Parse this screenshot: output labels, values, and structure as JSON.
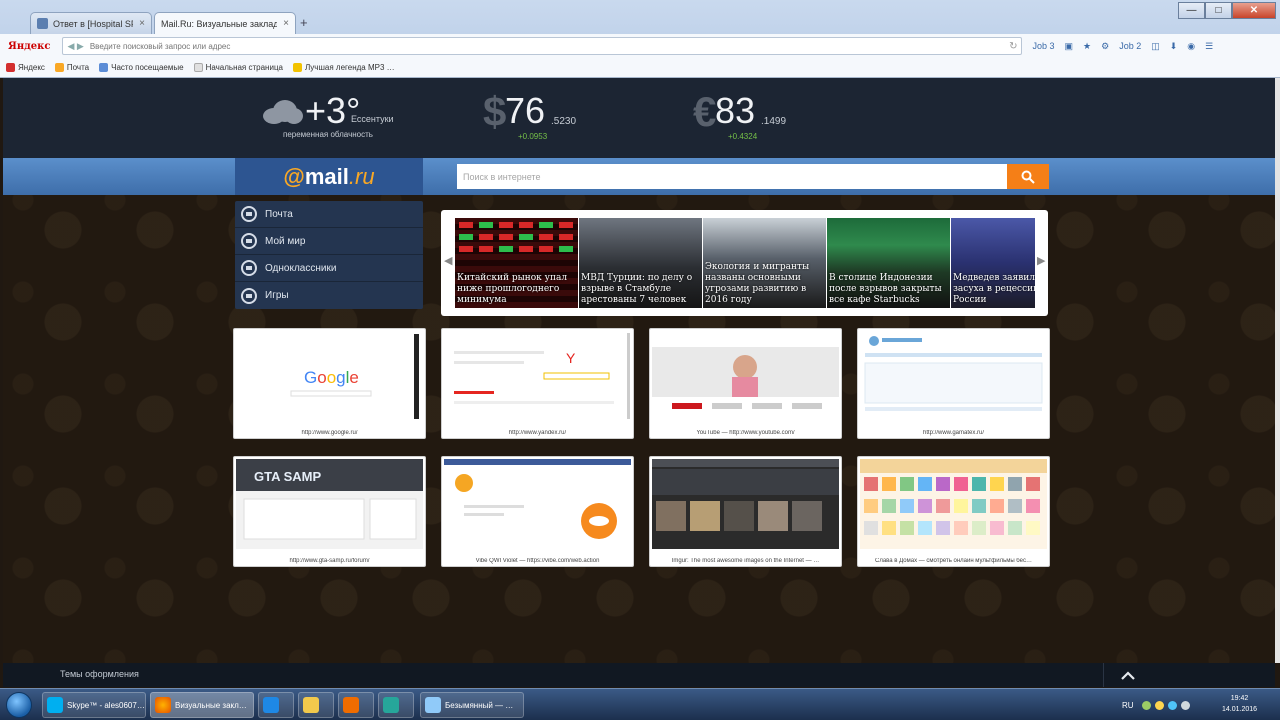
{
  "browser": {
    "tabs": [
      {
        "title": "Ответ в [Hospital SF] Отча…",
        "active": false
      },
      {
        "title": "Mail.Ru: Визуальные закладки",
        "active": true
      }
    ],
    "new_tab": "+",
    "window_buttons": {
      "minimize": "—",
      "maximize": "□",
      "close": "✕"
    },
    "search_brand": "Яндекс",
    "address_placeholder": "Введите поисковый запрос или адрес",
    "toolbar": [
      "Job 3",
      "Job 2"
    ],
    "bookmarks": [
      {
        "label": "Яндекс",
        "color": "#d32f2f"
      },
      {
        "label": "Почта",
        "color": "#f9a825"
      },
      {
        "label": "Часто посещаемые",
        "color": "#5c8dd6"
      },
      {
        "label": "Начальная страница",
        "color": "#e0e0e0"
      },
      {
        "label": "Лучшая легенда MP3 …",
        "color": "#f2c200"
      }
    ]
  },
  "weather": {
    "temp": "+3°",
    "city": "Ессентуки",
    "desc": "переменная облачность"
  },
  "currencies": [
    {
      "symbol": "$",
      "value": "76",
      "fraction": ".5230",
      "change": "+0.0953"
    },
    {
      "symbol": "€",
      "value": "83",
      "fraction": ".1499",
      "change": "+0.4324"
    }
  ],
  "logo": {
    "at": "@",
    "name": "mail",
    "tld": ".ru"
  },
  "search": {
    "placeholder": "Поиск в интернете"
  },
  "menu": [
    {
      "label": "Почта",
      "icon": "mail-icon"
    },
    {
      "label": "Мой мир",
      "icon": "myworld-icon"
    },
    {
      "label": "Одноклассники",
      "icon": "odnoklassniki-icon"
    },
    {
      "label": "Игры",
      "icon": "games-icon"
    }
  ],
  "news": [
    {
      "caption": "Китайский рынок упал ниже прошлогоднего минимума"
    },
    {
      "caption": "МВД Турции: по делу о взрыве в Стамбуле арестованы 7 человек"
    },
    {
      "caption": "Экология и мигранты названы основными угрозами развитию в 2016 году"
    },
    {
      "caption": "В столице Индонезии после взрывов закрыты все кафе Starbucks"
    },
    {
      "caption": "Медведев заявил о засуха в рецессии в России"
    }
  ],
  "news_nav": {
    "prev": "◀",
    "next": "▶"
  },
  "tiles": [
    {
      "label": "http://www.google.ru/"
    },
    {
      "label": "http://www.yandex.ru/"
    },
    {
      "label": "YouTube — http://www.youtube.com/"
    },
    {
      "label": "http://www.gamatex.ru/"
    },
    {
      "label": "http://www.gta-samp.ru/forum/"
    },
    {
      "label": "Vibe QWI Violet — https://vibe.com/web.action"
    },
    {
      "label": "Imgur: The most awesome images on the Internet — …"
    },
    {
      "label": "Слава в Домах — смотреть онлайн мультфильмы бес…"
    }
  ],
  "footer": {
    "themes": "Темы оформления"
  },
  "taskbar": {
    "tasks": [
      {
        "label": "Skype™ - ales0607…"
      },
      {
        "label": "Визуальные закл…"
      },
      {
        "label": ""
      },
      {
        "label": ""
      },
      {
        "label": ""
      },
      {
        "label": ""
      },
      {
        "label": "Безымянный — …"
      }
    ],
    "lang": "RU",
    "time": "19:42",
    "date": "14.01.2016"
  }
}
